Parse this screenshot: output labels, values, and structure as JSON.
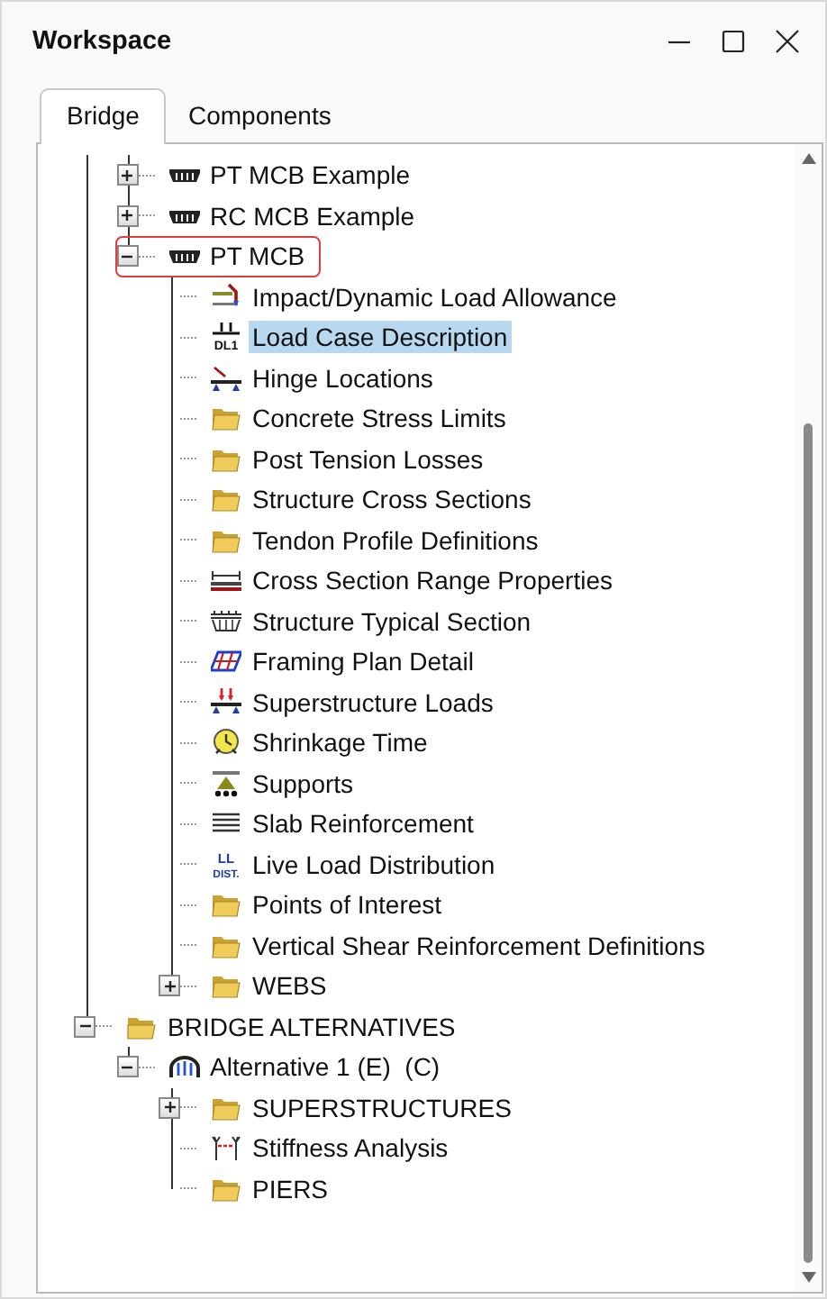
{
  "window": {
    "title": "Workspace"
  },
  "tabs": [
    {
      "label": "Bridge",
      "selected": true
    },
    {
      "label": "Components",
      "selected": false
    }
  ],
  "tree": {
    "upper_branch": [
      {
        "label": "PT MCB Example",
        "kind": "girder",
        "expanded": false,
        "selected": false,
        "outlined": false
      },
      {
        "label": "RC MCB Example",
        "kind": "girder",
        "expanded": false,
        "selected": false,
        "outlined": false
      },
      {
        "label": "PT MCB",
        "kind": "girder",
        "expanded": true,
        "selected": false,
        "outlined": true,
        "children": [
          {
            "label": "Impact/Dynamic Load Allowance",
            "kind": "impact",
            "selected": false,
            "outlined": false
          },
          {
            "label": "Load Case Description",
            "kind": "load-case",
            "icon_text": "DL1",
            "selected": true,
            "outlined": false
          },
          {
            "label": "Hinge Locations",
            "kind": "hinge",
            "selected": false,
            "outlined": false
          },
          {
            "label": "Concrete Stress Limits",
            "kind": "folder",
            "selected": false,
            "outlined": false
          },
          {
            "label": "Post Tension Losses",
            "kind": "folder",
            "selected": false,
            "outlined": false
          },
          {
            "label": "Structure Cross Sections",
            "kind": "folder",
            "selected": false,
            "outlined": false
          },
          {
            "label": "Tendon Profile Definitions",
            "kind": "folder",
            "selected": false,
            "outlined": false
          },
          {
            "label": "Cross Section Range Properties",
            "kind": "range",
            "selected": false,
            "outlined": false
          },
          {
            "label": "Structure Typical Section",
            "kind": "typical-section",
            "selected": false,
            "outlined": false
          },
          {
            "label": "Framing Plan Detail",
            "kind": "framing",
            "selected": false,
            "outlined": false
          },
          {
            "label": "Superstructure Loads",
            "kind": "loads",
            "selected": false,
            "outlined": false
          },
          {
            "label": "Shrinkage Time",
            "kind": "clock",
            "selected": false,
            "outlined": false
          },
          {
            "label": "Supports",
            "kind": "supports",
            "selected": false,
            "outlined": false
          },
          {
            "label": "Slab Reinforcement",
            "kind": "slab",
            "selected": false,
            "outlined": false
          },
          {
            "label": "Live Load Distribution",
            "kind": "live-load",
            "icon_text": "LL",
            "icon_subtext": "DIST.",
            "selected": false,
            "outlined": false
          },
          {
            "label": "Points of Interest",
            "kind": "folder",
            "selected": false,
            "outlined": false
          },
          {
            "label": "Vertical Shear Reinforcement Definitions",
            "kind": "folder",
            "selected": false,
            "outlined": false
          },
          {
            "label": "WEBS",
            "kind": "folder",
            "expanded": false,
            "selected": false,
            "outlined": false
          }
        ]
      }
    ],
    "items": [
      {
        "label": "BRIDGE ALTERNATIVES",
        "kind": "open-folder",
        "expanded": true,
        "selected": false,
        "outlined": false,
        "children": [
          {
            "label": "Alternative 1 (E)  (C)",
            "kind": "alternative",
            "expanded": true,
            "selected": false,
            "outlined": false,
            "children": [
              {
                "label": "SUPERSTRUCTURES",
                "kind": "folder",
                "expanded": false,
                "selected": false,
                "outlined": false
              },
              {
                "label": "Stiffness Analysis",
                "kind": "stiffness",
                "selected": false,
                "outlined": false
              },
              {
                "label": "PIERS",
                "kind": "folder",
                "selected": false,
                "outlined": false
              }
            ]
          }
        ]
      }
    ]
  }
}
